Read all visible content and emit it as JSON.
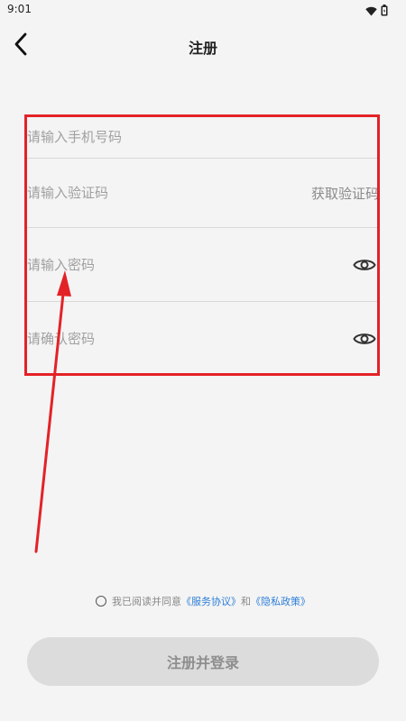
{
  "status_bar": {
    "time": "9:01",
    "icons": [
      "wifi-icon",
      "battery-icon"
    ]
  },
  "header": {
    "title": "注册",
    "back_icon": "chevron-left-icon"
  },
  "form": {
    "phone": {
      "placeholder": "请输入手机号码",
      "value": ""
    },
    "code": {
      "placeholder": "请输入验证码",
      "value": "",
      "action_label": "获取验证码"
    },
    "password": {
      "placeholder": "请输入密码",
      "value": "",
      "toggle_icon": "eye-icon"
    },
    "confirm_password": {
      "placeholder": "请确认密码",
      "value": "",
      "toggle_icon": "eye-icon"
    }
  },
  "agreement": {
    "prefix": "我已阅读并同意",
    "service_link": "《服务协议》",
    "conjunction": "和",
    "privacy_link": "《隐私政策》"
  },
  "submit": {
    "label": "注册并登录"
  },
  "colors": {
    "annotation": "#e32227",
    "link": "#2f7fd8",
    "button_bg": "#dcdcdc"
  }
}
